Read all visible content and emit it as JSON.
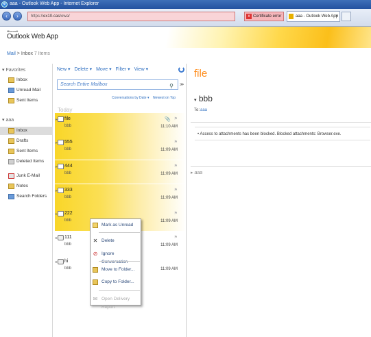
{
  "browser": {
    "title": "aaa - Outlook Web App - Internet Explorer",
    "address": "https://ex10-cas/owa/",
    "address_scheme": "https://",
    "address_host": "ex10-cas",
    "address_path": "/owa/",
    "cert_error": "Certificate error",
    "tab_title": "aaa - Outlook Web App"
  },
  "app": {
    "brand_small": "Microsoft",
    "brand": "Outlook Web App"
  },
  "breadcrumb": {
    "mail": "Mail",
    "sep": ">",
    "folder": "Inbox",
    "count": "7 Items"
  },
  "favorites": {
    "header": "Favorites",
    "items": [
      {
        "label": "Inbox"
      },
      {
        "label": "Unread Mail"
      },
      {
        "label": "Sent Items"
      }
    ]
  },
  "mailbox": {
    "header": "aaa",
    "items": [
      {
        "label": "Inbox",
        "selected": true
      },
      {
        "label": "Drafts"
      },
      {
        "label": "Sent Items"
      },
      {
        "label": "Deleted Items"
      },
      {
        "label": "Junk E-Mail"
      },
      {
        "label": "Notes"
      },
      {
        "label": "Search Folders"
      }
    ]
  },
  "toolbar": {
    "new": "New ▾",
    "delete": "Delete ▾",
    "move": "Move ▾",
    "filter": "Filter ▾",
    "view": "View ▾"
  },
  "search": {
    "placeholder": "Search Entire Mailbox"
  },
  "sort": {
    "by": "Conversations by Date ▾",
    "order": "Newest on Top"
  },
  "group_label": "Today",
  "messages": [
    {
      "subject": "file",
      "from": "bbb",
      "time": "11:10 AM",
      "highlighted": true,
      "attachment": true
    },
    {
      "subject": "555",
      "from": "bbb",
      "time": "11:09 AM",
      "highlighted": true
    },
    {
      "subject": "444",
      "from": "bbb",
      "time": "11:09 AM",
      "highlighted": true
    },
    {
      "subject": "333",
      "from": "bbb",
      "time": "11:09 AM",
      "highlighted": true
    },
    {
      "subject": "222",
      "from": "bbb",
      "time": "11:09 AM",
      "highlighted": true
    },
    {
      "subject": "111",
      "from": "bbb",
      "time": "11:09 AM",
      "highlighted": false
    },
    {
      "subject": "hi",
      "from": "bbb",
      "time": "11:09 AM",
      "highlighted": false
    }
  ],
  "context_menu": {
    "items": [
      {
        "label": "Mark as Unread",
        "icon": "mark-unread-icon"
      },
      {
        "label": "Delete",
        "icon": "delete-icon"
      },
      {
        "label": "Ignore Conversation",
        "icon": "ignore-icon"
      },
      {
        "label": "Move to Folder...",
        "icon": "move-folder-icon"
      },
      {
        "label": "Copy to Folder...",
        "icon": "copy-folder-icon"
      },
      {
        "label": "Open Delivery Report",
        "icon": "delivery-report-icon",
        "disabled": true
      }
    ]
  },
  "reading_pane": {
    "subject": "file",
    "sender": "bbb",
    "to_label": "To:",
    "to": "aaa",
    "info": "Access to attachments has been blocked. Blocked attachments: Browser.exe.",
    "conversation": "aaa"
  },
  "colors": {
    "accent": "#2d6ec0",
    "highlight": "#f9d628",
    "subject_orange": "#ff8c1a"
  }
}
